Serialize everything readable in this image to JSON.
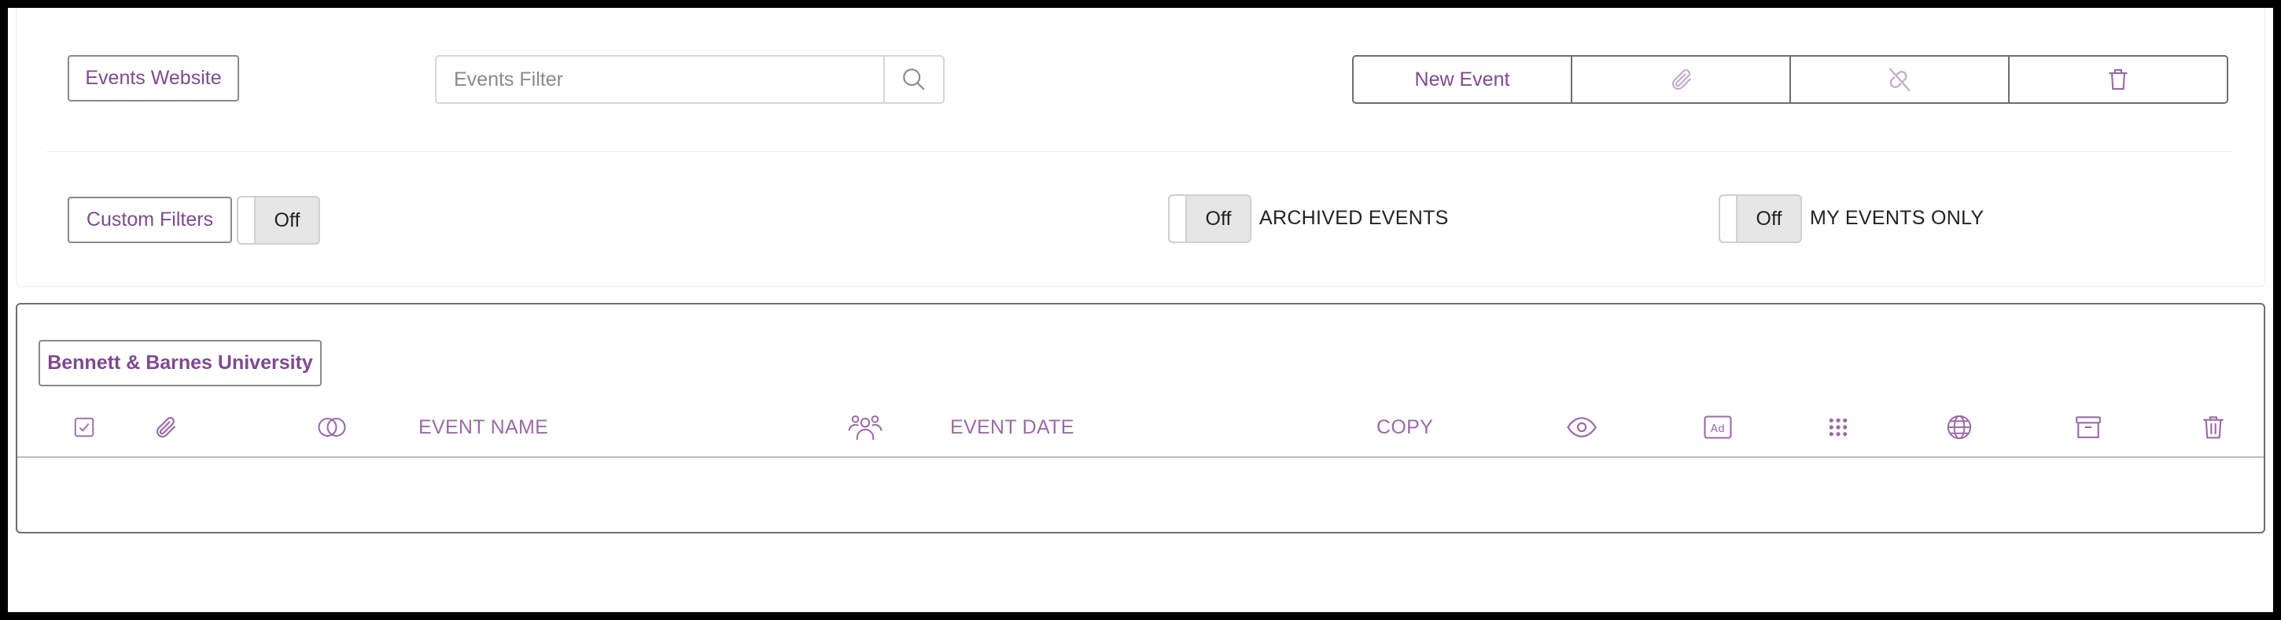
{
  "toolbar": {
    "events_website_label": "Events Website",
    "filter_placeholder": "Events Filter",
    "new_event_label": "New Event",
    "custom_filters_label": "Custom Filters"
  },
  "toggles": {
    "custom_filters": {
      "state": "Off"
    },
    "archived_events": {
      "state": "Off",
      "label": "ARCHIVED EVENTS"
    },
    "my_events_only": {
      "state": "Off",
      "label": "MY EVENTS ONLY"
    }
  },
  "table": {
    "organization_label": "Bennett & Barnes University",
    "columns": {
      "event_name": "EVENT NAME",
      "event_date": "EVENT DATE",
      "copy": "COPY"
    }
  },
  "icons": {
    "search": "search-icon",
    "attach": "paperclip-icon",
    "unlink": "unlink-icon",
    "delete": "trash-icon",
    "select_all": "checkbox-icon",
    "attachments": "paperclip-icon",
    "overlap": "overlap-circles-icon",
    "attendees": "people-icon",
    "view": "eye-icon",
    "ad": "ad-icon",
    "grid": "dots-grid-icon",
    "web": "globe-icon",
    "archive": "archive-icon",
    "remove": "trash-icon"
  },
  "colors": {
    "accent": "#7e4a8e",
    "column_header": "#9b6aa8"
  }
}
